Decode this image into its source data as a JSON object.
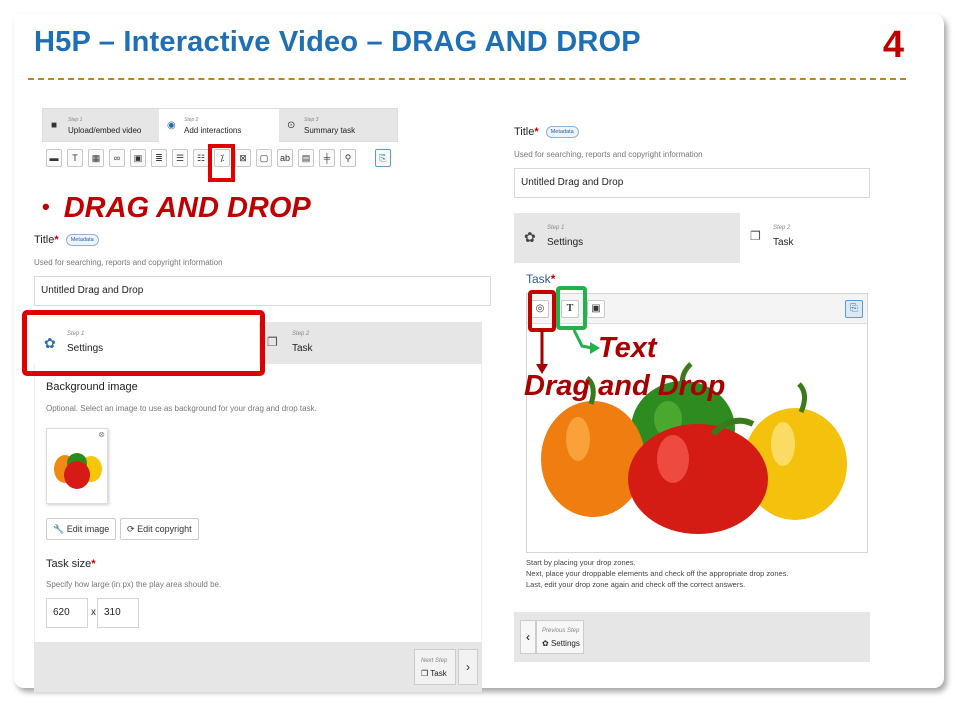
{
  "slide": {
    "title": "H5P – Interactive Video – DRAG AND DROP",
    "number": "4",
    "bullet": "DRAG AND DROP"
  },
  "interactive_video_editor": {
    "steps": [
      {
        "step": "Step 1",
        "label": "Upload/embed video",
        "icon": "video-camera-icon"
      },
      {
        "step": "Step 2",
        "label": "Add interactions",
        "icon": "lightbulb-icon"
      },
      {
        "step": "Step 3",
        "label": "Summary task",
        "icon": "check-circle-icon"
      }
    ],
    "toolbar_icons": [
      "label-icon",
      "text-icon",
      "table-icon",
      "link-icon",
      "image-icon",
      "statements-icon",
      "single-choice-icon",
      "multiple-choice-icon",
      "drag-and-drop-icon",
      "mark-the-words-icon",
      "drag-text-icon",
      "fill-blanks-icon",
      "summary-icon",
      "crossroads-icon",
      "navigation-hotspot-icon",
      "questionset-icon",
      "paste-icon"
    ],
    "drag_drop_glyph": "⁒"
  },
  "left_editor": {
    "title_label": "Title",
    "required_mark": "*",
    "metadata_button": "Metadata",
    "title_help": "Used for searching, reports and copyright information",
    "title_value": "Untitled Drag and Drop",
    "steps": [
      {
        "step": "Step 1",
        "label": "Settings"
      },
      {
        "step": "Step 2",
        "label": "Task"
      }
    ],
    "background_label": "Background image",
    "background_help": "Optional. Select an image to use as background for your drag and drop task.",
    "edit_image": "Edit image",
    "edit_copyright": "Edit copyright",
    "task_size_label": "Task size",
    "task_size_help": "Specify how large (in px) the play area should be.",
    "width": "620",
    "times": "x",
    "height": "310",
    "next_step": "Next Step",
    "next_step_label": "Task"
  },
  "right_editor": {
    "title_label": "Title",
    "required_mark": "*",
    "metadata_button": "Metadata",
    "title_help": "Used for searching, reports and copyright information",
    "title_value": "Untitled Drag and Drop",
    "steps": [
      {
        "step": "Step 1",
        "label": "Settings"
      },
      {
        "step": "Step 2",
        "label": "Task"
      }
    ],
    "task_label": "Task",
    "instructions": [
      "Start by placing your drop zones.",
      "Next, place your droppable elements and check off the appropriate drop zones.",
      "Last, edit your drop zone again and check off the correct answers."
    ],
    "previous_step": "Previous Step",
    "previous_step_label": "Settings",
    "annotation_text": "Text",
    "annotation_drag_drop": "Drag and Drop"
  },
  "colors": {
    "title_blue": "#1f6fb5",
    "highlight_red": "#e00000",
    "highlight_green": "#22b24c",
    "annotation_red": "#a80000"
  }
}
